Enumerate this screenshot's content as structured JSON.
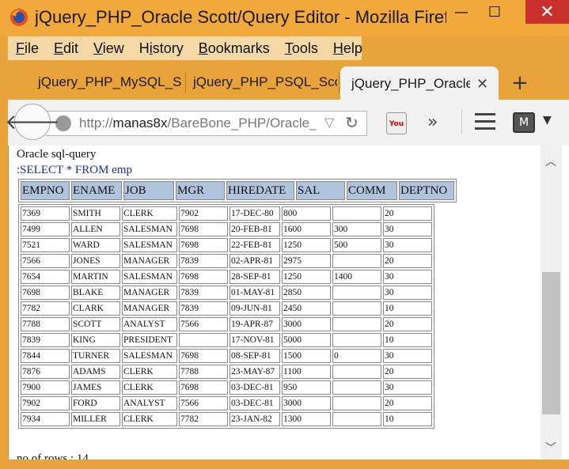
{
  "window": {
    "title": "jQuery_PHP_Oracle Scott/Query Editor - Mozilla Firefox",
    "minimize": "—",
    "maximize": "☐",
    "close": "✕"
  },
  "menu": [
    "File",
    "Edit",
    "View",
    "History",
    "Bookmarks",
    "Tools",
    "Help"
  ],
  "menu_access_keys": [
    "F",
    "E",
    "V",
    "i",
    "B",
    "T",
    "H"
  ],
  "tabs": [
    {
      "label": "jQuery_PHP_MySQL_Scott",
      "active": false
    },
    {
      "label": "jQuery_PHP_PSQL_Scott",
      "active": false
    },
    {
      "label": "jQuery_PHP_Oracle Scott",
      "active": true
    }
  ],
  "tab_close": "✕",
  "new_tab": "+",
  "nav": {
    "url_prefix": "http://",
    "url_host": "manas8x",
    "url_path": "/BareBone_PHP/Oracle_Scott/",
    "back": "🡐",
    "dropdown": "▽",
    "reload": "↻",
    "overflow": "»",
    "yt_label": "You"
  },
  "page": {
    "heading": "Oracle sql-query",
    "query": ":SELECT * FROM emp",
    "rows_label": "no of rows : 14"
  },
  "table": {
    "columns": [
      "EMPNO",
      "ENAME",
      "JOB",
      "MGR",
      "HIREDATE",
      "SAL",
      "COMM",
      "DEPTNO"
    ],
    "rows": [
      [
        "7369",
        "SMITH",
        "CLERK",
        "7902",
        "17-DEC-80",
        "800",
        "",
        "20"
      ],
      [
        "7499",
        "ALLEN",
        "SALESMAN",
        "7698",
        "20-FEB-81",
        "1600",
        "300",
        "30"
      ],
      [
        "7521",
        "WARD",
        "SALESMAN",
        "7698",
        "22-FEB-81",
        "1250",
        "500",
        "30"
      ],
      [
        "7566",
        "JONES",
        "MANAGER",
        "7839",
        "02-APR-81",
        "2975",
        "",
        "20"
      ],
      [
        "7654",
        "MARTIN",
        "SALESMAN",
        "7698",
        "28-SEP-81",
        "1250",
        "1400",
        "30"
      ],
      [
        "7698",
        "BLAKE",
        "MANAGER",
        "7839",
        "01-MAY-81",
        "2850",
        "",
        "30"
      ],
      [
        "7782",
        "CLARK",
        "MANAGER",
        "7839",
        "09-JUN-81",
        "2450",
        "",
        "10"
      ],
      [
        "7788",
        "SCOTT",
        "ANALYST",
        "7566",
        "19-APR-87",
        "3000",
        "",
        "20"
      ],
      [
        "7839",
        "KING",
        "PRESIDENT",
        "",
        "17-NOV-81",
        "5000",
        "",
        "10"
      ],
      [
        "7844",
        "TURNER",
        "SALESMAN",
        "7698",
        "08-SEP-81",
        "1500",
        "0",
        "30"
      ],
      [
        "7876",
        "ADAMS",
        "CLERK",
        "7788",
        "23-MAY-87",
        "1100",
        "",
        "20"
      ],
      [
        "7900",
        "JAMES",
        "CLERK",
        "7698",
        "03-DEC-81",
        "950",
        "",
        "30"
      ],
      [
        "7902",
        "FORD",
        "ANALYST",
        "7566",
        "03-DEC-81",
        "3000",
        "",
        "20"
      ],
      [
        "7934",
        "MILLER",
        "CLERK",
        "7782",
        "23-JAN-82",
        "1300",
        "",
        "10"
      ]
    ]
  },
  "colors": {
    "titlebar": "#f0a93a",
    "header_cell": "#b0c4de",
    "query_text": "#1a2d9e",
    "close_button": "#c9302c"
  },
  "icons": [
    "firefox-logo-icon",
    "back-arrow-icon",
    "globe-icon",
    "youtube-icon",
    "hamburger-menu-icon",
    "shield-icon"
  ]
}
